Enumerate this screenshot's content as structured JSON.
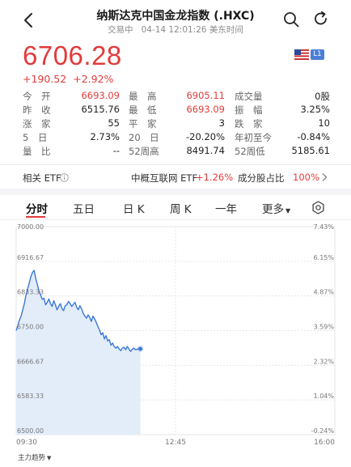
{
  "header": {
    "title": "纳斯达克中国金龙指数 (.HXC)",
    "status": "交易中",
    "time": "04-14 12:01:26 美东时间"
  },
  "quote": {
    "price": "6706.28",
    "change": "+190.52",
    "change_pct": "+2.92%",
    "market_badge": "L1"
  },
  "stats": [
    [
      {
        "label": "今　开",
        "value": "6693.09",
        "color": "red"
      },
      {
        "label": "最　高",
        "value": "6905.11",
        "color": "red"
      },
      {
        "label": "成交量",
        "value": "0股",
        "color": "dark"
      }
    ],
    [
      {
        "label": "昨　收",
        "value": "6515.76",
        "color": "dark"
      },
      {
        "label": "最　低",
        "value": "6693.09",
        "color": "red"
      },
      {
        "label": "振　幅",
        "value": "3.25%",
        "color": "dark"
      }
    ],
    [
      {
        "label": "涨　家",
        "value": "55",
        "color": "dark"
      },
      {
        "label": "平　家",
        "value": "3",
        "color": "dark"
      },
      {
        "label": "跌　家",
        "value": "10",
        "color": "dark"
      }
    ],
    [
      {
        "label": "5　日",
        "value": "2.73%",
        "color": "dark"
      },
      {
        "label": "20　日",
        "value": "-20.20%",
        "color": "dark"
      },
      {
        "label": "年初至今",
        "value": "-0.84%",
        "color": "dark"
      }
    ],
    [
      {
        "label": "量　比",
        "value": "--",
        "color": "dark"
      },
      {
        "label": "52周高",
        "value": "8491.74",
        "color": "dark"
      },
      {
        "label": "52周低",
        "value": "5185.61",
        "color": "dark"
      }
    ]
  ],
  "etf_bar": {
    "label": "相关 ETF",
    "etf_name": "中概互联网 ETF",
    "etf_change": "+1.26%",
    "share_label": "成分股占比",
    "share_value": "100%"
  },
  "tabs": [
    "分时",
    "五日",
    "日 K",
    "周 K",
    "一年",
    "更多"
  ],
  "colors": {
    "up": "#e23b3b",
    "line": "#3a78d8",
    "fill": "#e3edfa",
    "grid": "#e6e6e6"
  },
  "chart_data": {
    "type": "area",
    "y_left_ticks": [
      "7000.00",
      "6916.67",
      "6833.33",
      "6750.00",
      "6666.67",
      "6583.33",
      "6500.00"
    ],
    "y_right_ticks": [
      "7.43%",
      "6.15%",
      "4.87%",
      "3.59%",
      "2.32%",
      "1.04%",
      "-0.24%"
    ],
    "x_ticks": [
      "09:30",
      "12:45",
      "16:00"
    ],
    "ylim": [
      6500,
      7000
    ],
    "x_minutes_range": [
      0,
      390
    ],
    "series": [
      {
        "x": [
          0,
          2,
          4,
          6,
          8,
          10,
          12,
          14,
          16,
          18,
          20,
          22,
          24,
          26,
          28,
          30,
          32,
          34,
          36,
          38,
          40,
          42,
          44,
          46,
          48,
          50,
          52,
          54,
          56,
          58,
          60,
          62,
          64,
          66,
          68,
          70,
          72,
          74,
          76,
          78,
          80,
          82,
          84,
          86,
          88,
          90,
          92,
          94,
          96,
          98,
          100,
          102,
          104,
          106,
          108,
          110,
          112,
          114,
          116,
          118,
          120,
          122,
          124,
          126,
          128,
          130,
          132,
          134,
          136,
          138,
          140,
          142,
          144,
          146,
          148,
          150,
          152
        ],
        "y": [
          6750,
          6762,
          6775,
          6785,
          6800,
          6815,
          6835,
          6850,
          6865,
          6880,
          6890,
          6895,
          6875,
          6860,
          6845,
          6835,
          6825,
          6828,
          6812,
          6818,
          6826,
          6815,
          6808,
          6822,
          6812,
          6800,
          6808,
          6815,
          6803,
          6798,
          6810,
          6812,
          6820,
          6815,
          6808,
          6813,
          6818,
          6806,
          6800,
          6810,
          6803,
          6792,
          6785,
          6780,
          6788,
          6782,
          6772,
          6785,
          6778,
          6770,
          6760,
          6752,
          6740,
          6745,
          6730,
          6738,
          6725,
          6728,
          6715,
          6720,
          6712,
          6708,
          6712,
          6706,
          6702,
          6708,
          6710,
          6704,
          6712,
          6706,
          6700,
          6705,
          6708,
          6704,
          6705,
          6706.28,
          6706.28
        ]
      }
    ]
  },
  "chart_labels": {
    "bottom_indicator": "主力趋势"
  }
}
